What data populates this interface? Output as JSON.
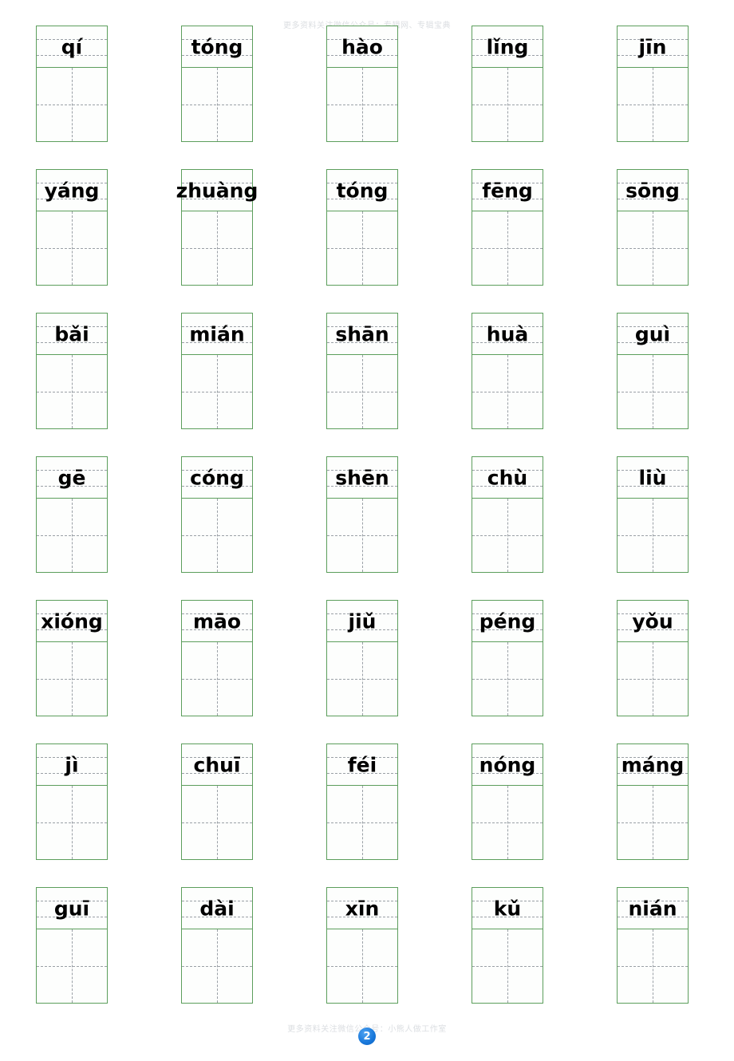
{
  "page": {
    "number_badge": "2",
    "watermark_top": "更多资料关注微信公众号：专辑网、专辑宝典",
    "watermark_bottom": "更多资料关注微信公众号：小熊人做工作室"
  },
  "worksheet": {
    "rows": [
      [
        {
          "pinyin": "qí"
        },
        {
          "pinyin": "tóng"
        },
        {
          "pinyin": "hào"
        },
        {
          "pinyin": "lǐng"
        },
        {
          "pinyin": "jīn"
        }
      ],
      [
        {
          "pinyin": "yáng"
        },
        {
          "pinyin": "zhuàng"
        },
        {
          "pinyin": "tóng"
        },
        {
          "pinyin": "fēng"
        },
        {
          "pinyin": "sōng"
        }
      ],
      [
        {
          "pinyin": "bǎi"
        },
        {
          "pinyin": "mián"
        },
        {
          "pinyin": "shān"
        },
        {
          "pinyin": "huà"
        },
        {
          "pinyin": "guì"
        }
      ],
      [
        {
          "pinyin": "gē"
        },
        {
          "pinyin": "cóng"
        },
        {
          "pinyin": "shēn"
        },
        {
          "pinyin": "chù"
        },
        {
          "pinyin": "liù"
        }
      ],
      [
        {
          "pinyin": "xióng"
        },
        {
          "pinyin": "māo"
        },
        {
          "pinyin": "jiǔ"
        },
        {
          "pinyin": "péng"
        },
        {
          "pinyin": "yǒu"
        }
      ],
      [
        {
          "pinyin": "jì"
        },
        {
          "pinyin": "chuī"
        },
        {
          "pinyin": "féi"
        },
        {
          "pinyin": "nóng"
        },
        {
          "pinyin": "máng"
        }
      ],
      [
        {
          "pinyin": "guī"
        },
        {
          "pinyin": "dài"
        },
        {
          "pinyin": "xīn"
        },
        {
          "pinyin": "kǔ"
        },
        {
          "pinyin": "nián"
        }
      ]
    ]
  },
  "colors": {
    "cell_border": "#5c9e5c",
    "guide_line": "#9aa0a6",
    "badge": "#1675d8",
    "watermark": "#cfd3d8"
  }
}
